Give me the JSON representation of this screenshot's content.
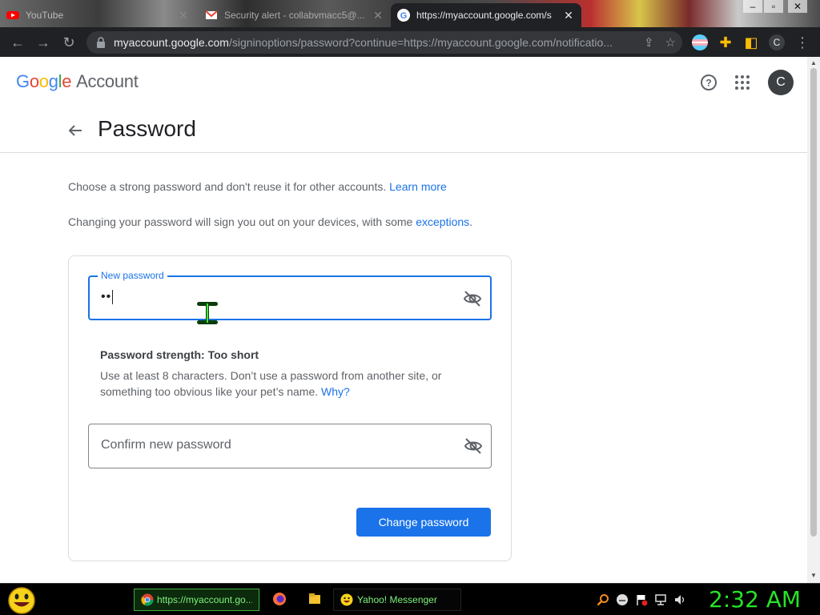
{
  "browser": {
    "tabs": [
      {
        "label": "YouTube",
        "active": false
      },
      {
        "label": "Security alert - collabvmacc5@...",
        "active": false
      },
      {
        "label": "https://myaccount.google.com/s",
        "active": true
      }
    ],
    "url_host": "myaccount.google.com",
    "url_path": "/signinoptions/password?continue=https://myaccount.google.com/notificatio...",
    "profile_initial": "C"
  },
  "header": {
    "logo_letters": [
      "G",
      "o",
      "o",
      "g",
      "l",
      "e"
    ],
    "logo_suffix": "Account",
    "avatar_initial": "C"
  },
  "page": {
    "title": "Password",
    "intro_line1": "Choose a strong password and don't reuse it for other accounts.",
    "learn_more": "Learn more",
    "intro_line2": "Changing your password will sign you out on your devices, with some",
    "exceptions": "exceptions",
    "intro_line2_end": "."
  },
  "form": {
    "new_password_label": "New password",
    "new_password_value": "••",
    "strength": "Password strength: Too short",
    "advice": "Use at least 8 characters. Don’t use a password from another site, or something too obvious like your pet’s name.",
    "why_link": "Why?",
    "confirm_placeholder": "Confirm new password",
    "submit_label": "Change password"
  },
  "taskbar": {
    "chrome_task": "https://myaccount.go...",
    "yahoo_task": "Yahoo! Messenger",
    "clock": "2:32 AM"
  },
  "colors": {
    "accent": "#1a73e8",
    "taskbar_text": "#27e327"
  }
}
